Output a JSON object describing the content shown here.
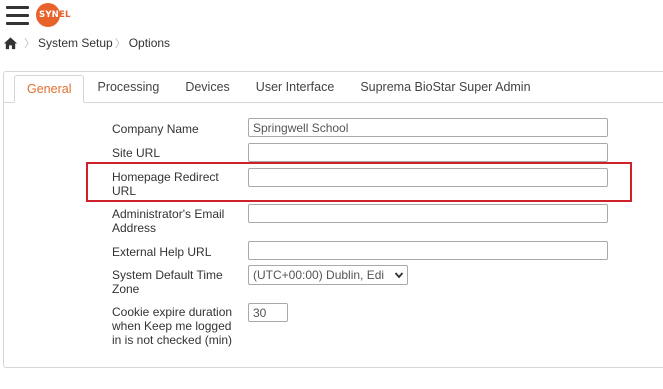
{
  "logo": {
    "text_main": "SYN",
    "text_tail": "EL"
  },
  "breadcrumb": {
    "home_icon": "home-icon",
    "items": [
      "System Setup",
      "Options"
    ]
  },
  "tabs": [
    {
      "label": "General",
      "active": true
    },
    {
      "label": "Processing",
      "active": false
    },
    {
      "label": "Devices",
      "active": false
    },
    {
      "label": "User Interface",
      "active": false
    },
    {
      "label": "Suprema BioStar Super Admin",
      "active": false
    }
  ],
  "form": {
    "company_name": {
      "label": "Company Name",
      "value": "Springwell School"
    },
    "site_url": {
      "label": "Site URL",
      "value": ""
    },
    "homepage_redirect_url": {
      "label_line1": "Homepage Redirect",
      "label_line2": "URL",
      "value": ""
    },
    "admin_email": {
      "label_line1": "Administrator's Email",
      "label_line2": "Address",
      "value": ""
    },
    "external_help_url": {
      "label": "External Help URL",
      "value": ""
    },
    "default_time_zone": {
      "label_line1": "System Default Time",
      "label_line2": "Zone",
      "value": "(UTC+00:00) Dublin, Edi"
    },
    "cookie_expire": {
      "label_line1": "Cookie expire duration",
      "label_line2": "when Keep me logged",
      "label_line3": "in is not checked (min)",
      "value": "30"
    }
  },
  "colors": {
    "accent": "#e0702d",
    "logo": "#e8632b",
    "highlight": "#d0202a"
  }
}
